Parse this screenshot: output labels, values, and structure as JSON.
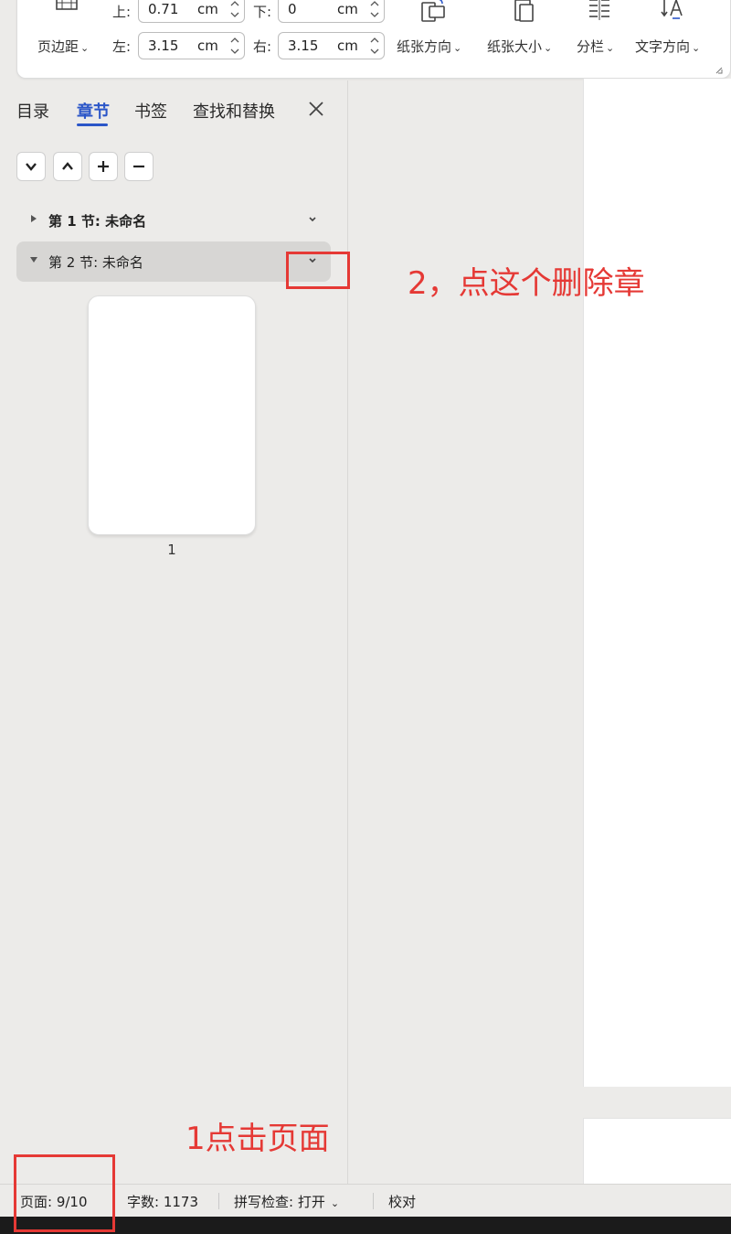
{
  "ribbon": {
    "margin_label": "页边距",
    "top_label": "上:",
    "top_value": "0.71",
    "bottom_label": "下:",
    "bottom_value": "0",
    "left_label": "左:",
    "left_value": "3.15",
    "right_label": "右:",
    "right_value": "3.15",
    "unit": "cm",
    "orientation_label": "纸张方向",
    "size_label": "纸张大小",
    "columns_label": "分栏",
    "text_direction_label": "文字方向"
  },
  "panel": {
    "tabs": [
      {
        "label": "目录"
      },
      {
        "label": "章节"
      },
      {
        "label": "书签"
      },
      {
        "label": "查找和替换"
      }
    ],
    "sections": [
      {
        "label": "第 1 节: 未命名"
      },
      {
        "label": "第 2 节: 未命名"
      }
    ],
    "thumbnail_number": "1"
  },
  "status": {
    "page": "页面: 9/10",
    "words": "字数: 1173",
    "spell": "拼写检查: 打开",
    "proof": "校对"
  },
  "annotations": {
    "step2": "2，点这个删除章",
    "step1": "1点击页面"
  },
  "colors": {
    "accent": "#2b56c8",
    "annotation": "#e53935"
  }
}
